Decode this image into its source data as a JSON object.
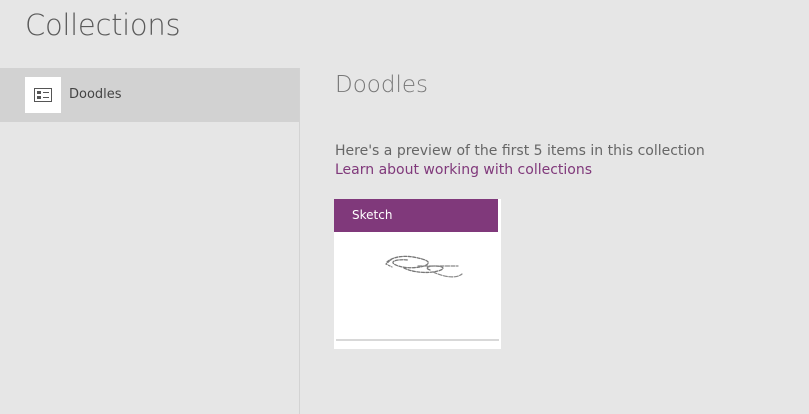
{
  "header": {
    "title": "Collections"
  },
  "sidebar": {
    "items": [
      {
        "label": "Doodles",
        "icon": "collection-icon",
        "selected": true
      }
    ]
  },
  "detail": {
    "title": "Doodles",
    "preview_text": "Here's a preview of the first 5 items in this collection",
    "learn_link": "Learn about working with collections",
    "cards": [
      {
        "label": "Sketch",
        "icon": "sketch-drawing"
      }
    ]
  },
  "colors": {
    "accent": "#80397b",
    "background": "#e6e6e6",
    "selected_item": "#d2d2d2"
  }
}
